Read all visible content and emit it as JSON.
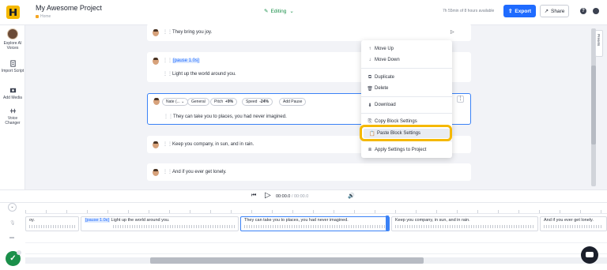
{
  "header": {
    "project_title": "My Awesome Project",
    "breadcrumb": "Home",
    "mode_label": "Editing",
    "usage_text": "7h 55min of 8 hours available",
    "export_label": "Export",
    "share_label": "Share"
  },
  "sidebar": {
    "items": [
      {
        "label": "Explore AI Voices"
      },
      {
        "label": "Import Script"
      },
      {
        "label": "Add Media"
      },
      {
        "label": "Voice Changer"
      }
    ]
  },
  "blocks": [
    {
      "text": "They bring you joy."
    },
    {
      "pause": "[pause 1.0s]",
      "text": "Light up the world around you."
    },
    {
      "text": "They can take you to places, you had never imagined.",
      "voice": "Nate (...",
      "style": "General",
      "pitch_label": "Pitch",
      "pitch_value": "+9%",
      "speed_label": "Speed",
      "speed_value": "-24%",
      "add_pause": "Add Pause"
    },
    {
      "text": "Keep you company, in sun, and in rain."
    },
    {
      "text": "And if you ever get lonely."
    }
  ],
  "context_menu": {
    "items": [
      {
        "label": "Move Up",
        "icon": "arrow-up-icon"
      },
      {
        "label": "Move Down",
        "icon": "arrow-down-icon"
      },
      {
        "label": "Duplicate",
        "icon": "duplicate-icon"
      },
      {
        "label": "Delete",
        "icon": "trash-icon"
      },
      {
        "label": "Download",
        "icon": "download-icon"
      },
      {
        "label": "Copy Block Settings",
        "icon": "copy-icon"
      },
      {
        "label": "Paste Block Settings",
        "icon": "paste-icon"
      },
      {
        "label": "Apply Settings to Project",
        "icon": "apply-icon"
      }
    ],
    "highlighted": "Paste Block Settings",
    "highlight_color": "#f5b800"
  },
  "presets_label": "Presets",
  "player": {
    "current_time": "00:00.0",
    "separator": "/",
    "total_time": "00:00.0"
  },
  "timeline": {
    "clips": [
      {
        "text": "oy."
      },
      {
        "pause": "[pause 1.0s]",
        "text": "Light up the world around you."
      },
      {
        "text": "They can take you to places, you had never imagined."
      },
      {
        "text": "Keep you company, in sun, and in rain."
      },
      {
        "text": "And if you ever get lonely."
      }
    ]
  },
  "colors": {
    "accent": "#1f6bff",
    "editing_green": "#1a8f4a",
    "selection_blue": "#3b82f6"
  }
}
